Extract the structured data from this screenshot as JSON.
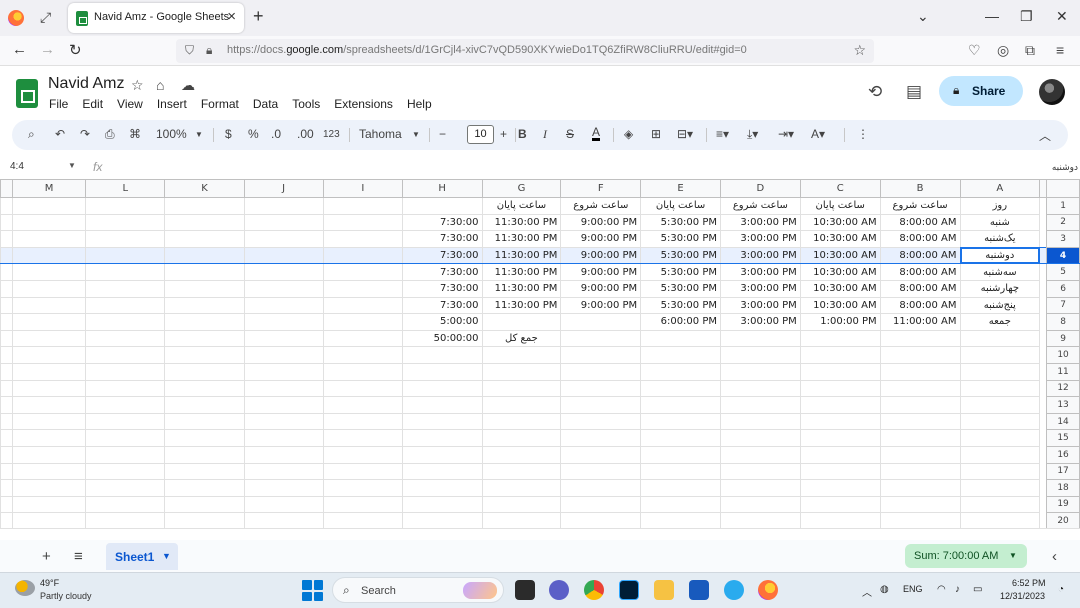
{
  "browser": {
    "tab_title": "Navid Amz - Google Sheets",
    "url_host_prefix": "https://docs.",
    "url_host": "google.com",
    "url_path": "/spreadsheets/d/1GrCjl4-xivC7vQD590XKYwieDo1TQ6ZfiRW8CliuRRU/edit#gid=0"
  },
  "doc": {
    "title": "Navid Amz",
    "menu": [
      "File",
      "Edit",
      "View",
      "Insert",
      "Format",
      "Data",
      "Tools",
      "Extensions",
      "Help"
    ],
    "share_label": "Share"
  },
  "toolbar": {
    "zoom": "100%",
    "currency": "$",
    "percent": "%",
    "dec_less": ".0",
    "dec_more": ".00",
    "number_format": "123",
    "font": "Tahoma",
    "font_size": "10",
    "bold": "B",
    "italic": "I",
    "underline_color_text": "A"
  },
  "formula_bar": {
    "name_box": "4:4",
    "fx": "fx",
    "value": "دوشنبه"
  },
  "grid": {
    "column_headers": [
      "M",
      "L",
      "K",
      "J",
      "I",
      "H",
      "G",
      "F",
      "E",
      "D",
      "C",
      "B",
      "A"
    ],
    "selected_row": 4,
    "rows": [
      {
        "n": "1",
        "A": "روز",
        "B": "ساعت شروع",
        "C": "ساعت پایان",
        "D": "ساعت شروع",
        "E": "ساعت پایان",
        "F": "ساعت شروع",
        "G": "ساعت پایان",
        "H": ""
      },
      {
        "n": "2",
        "A": "شنبه",
        "B": "8:00:00 AM",
        "C": "10:30:00 AM",
        "D": "3:00:00 PM",
        "E": "5:30:00 PM",
        "F": "9:00:00 PM",
        "G": "11:30:00 PM",
        "H": "7:30:00"
      },
      {
        "n": "3",
        "A": "یک‌شنبه",
        "B": "8:00:00 AM",
        "C": "10:30:00 AM",
        "D": "3:00:00 PM",
        "E": "5:30:00 PM",
        "F": "9:00:00 PM",
        "G": "11:30:00 PM",
        "H": "7:30:00"
      },
      {
        "n": "4",
        "A": "دوشنبه",
        "B": "8:00:00 AM",
        "C": "10:30:00 AM",
        "D": "3:00:00 PM",
        "E": "5:30:00 PM",
        "F": "9:00:00 PM",
        "G": "11:30:00 PM",
        "H": "7:30:00"
      },
      {
        "n": "5",
        "A": "سه‌شنبه",
        "B": "8:00:00 AM",
        "C": "10:30:00 AM",
        "D": "3:00:00 PM",
        "E": "5:30:00 PM",
        "F": "9:00:00 PM",
        "G": "11:30:00 PM",
        "H": "7:30:00"
      },
      {
        "n": "6",
        "A": "چهارشنبه",
        "B": "8:00:00 AM",
        "C": "10:30:00 AM",
        "D": "3:00:00 PM",
        "E": "5:30:00 PM",
        "F": "9:00:00 PM",
        "G": "11:30:00 PM",
        "H": "7:30:00"
      },
      {
        "n": "7",
        "A": "پنج‌شنبه",
        "B": "8:00:00 AM",
        "C": "10:30:00 AM",
        "D": "3:00:00 PM",
        "E": "5:30:00 PM",
        "F": "9:00:00 PM",
        "G": "11:30:00 PM",
        "H": "7:30:00"
      },
      {
        "n": "8",
        "A": "جمعه",
        "B": "11:00:00 AM",
        "C": "1:00:00 PM",
        "D": "3:00:00 PM",
        "E": "6:00:00 PM",
        "F": "",
        "G": "",
        "H": "5:00:00"
      },
      {
        "n": "9",
        "A": "",
        "B": "",
        "C": "",
        "D": "",
        "E": "",
        "F": "",
        "G": "جمع کل",
        "H": "50:00:00"
      },
      {
        "n": "10"
      },
      {
        "n": "11"
      },
      {
        "n": "12"
      },
      {
        "n": "13"
      },
      {
        "n": "14"
      },
      {
        "n": "15"
      },
      {
        "n": "16"
      },
      {
        "n": "17"
      },
      {
        "n": "18"
      },
      {
        "n": "19"
      },
      {
        "n": "20"
      }
    ]
  },
  "sheets": {
    "tab": "Sheet1",
    "sum": "Sum: 7:00:00 AM"
  },
  "taskbar": {
    "temp": "49°F",
    "weather": "Partly cloudy",
    "search": "Search",
    "lang": "ENG",
    "time": "6:52 PM",
    "date": "12/31/2023"
  }
}
